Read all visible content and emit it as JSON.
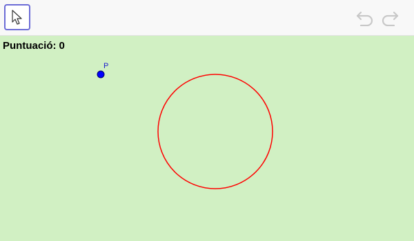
{
  "toolbar": {
    "active_tool_icon": "cursor-arrow-icon",
    "undo_icon": "undo-icon",
    "redo_icon": "redo-icon",
    "accent_color": "#6b6bd6",
    "disabled_icon_color": "#c8c8c8"
  },
  "graphics": {
    "background_color": "#d1f0c3",
    "score_label": "Puntuació:",
    "score_value": "0",
    "point": {
      "label": "P",
      "color": "#0000ff"
    },
    "circle": {
      "color": "#ff0000"
    }
  }
}
